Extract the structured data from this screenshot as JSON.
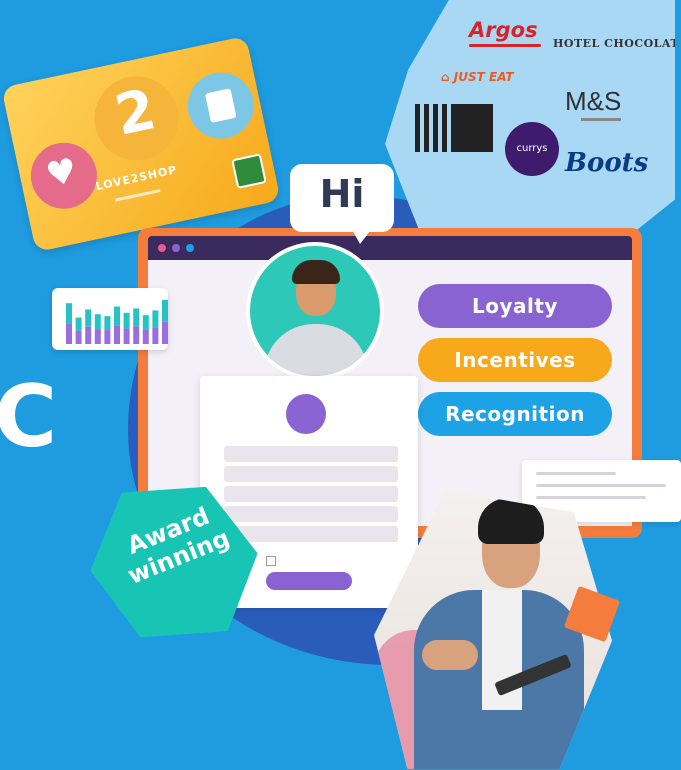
{
  "hero": {
    "left_letter": "C"
  },
  "gift_card": {
    "number": "2",
    "label": "LOVE2SHOP"
  },
  "speech_bubble": {
    "text": "Hi"
  },
  "pills": {
    "loyalty": "Loyalty",
    "incentives": "Incentives",
    "recognition": "Recognition"
  },
  "award": {
    "text": "Award winning"
  },
  "brands": {
    "argos": "Argos",
    "hotel": "HOTEL CHOCOLAT",
    "just_eat": "JUST EAT",
    "ms": "M&S",
    "currys": "currys",
    "boots": "Boots"
  },
  "chart": {
    "values": [
      0.85,
      0.55,
      0.72,
      0.62,
      0.58,
      0.78,
      0.65,
      0.74,
      0.6,
      0.7,
      0.92
    ],
    "colors": {
      "top": "#27c3c3",
      "bottom": "#9a6ee0"
    }
  },
  "colors": {
    "background": "#1f9be0",
    "purple": "#8a63d2",
    "orange": "#f7a81b",
    "blue": "#1ea2e6",
    "teal": "#18c4b3"
  }
}
